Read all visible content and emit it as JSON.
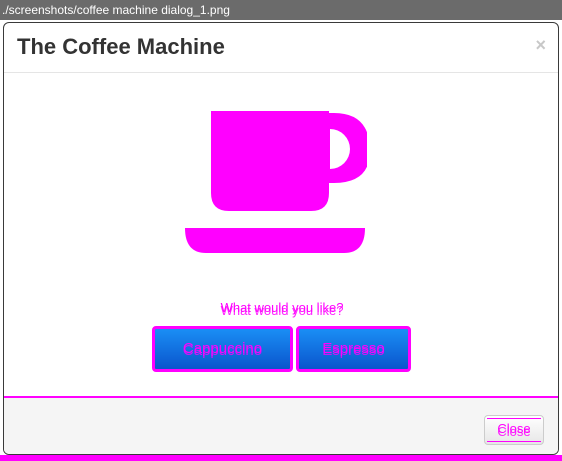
{
  "window": {
    "title": "./screenshots/coffee machine dialog_1.png"
  },
  "dialog": {
    "title": "The Coffee Machine",
    "close_icon": "×",
    "question": "What would you like?",
    "buttons": {
      "cappuccino": "Cappuccino",
      "espresso": "Espresso"
    },
    "footer_close": "Close"
  },
  "icons": {
    "cup": "coffee-cup-icon"
  },
  "colors": {
    "highlight": "#ff00ff",
    "button_top": "#1a8ef5",
    "button_bottom": "#0a55cc",
    "titlebar": "#6b6b6b"
  }
}
